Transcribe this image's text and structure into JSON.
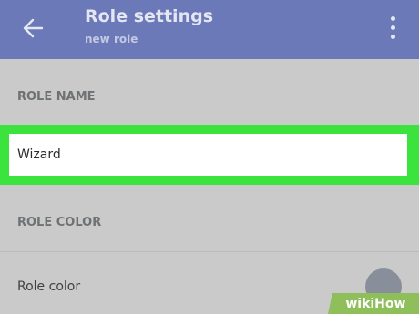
{
  "appbar": {
    "title": "Role settings",
    "subtitle": "new role",
    "back_icon": "arrow-left-icon",
    "menu_icon": "more-vert-icon",
    "color": "#6b79b8"
  },
  "role_name": {
    "header": "ROLE NAME",
    "value": "Wizard",
    "highlight_color": "#3ce33c"
  },
  "role_color": {
    "header": "ROLE COLOR",
    "row_label": "Role color",
    "swatch_color": "#888e9a"
  },
  "watermark": {
    "text": "wikiHow"
  }
}
